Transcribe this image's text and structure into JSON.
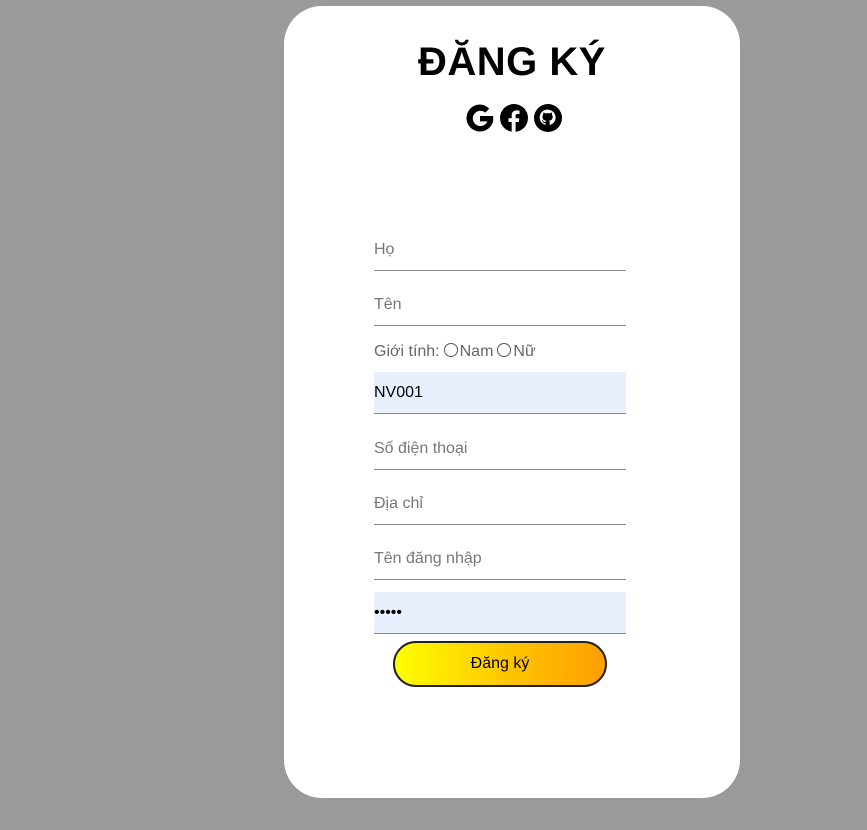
{
  "form": {
    "title": "ĐĂNG KÝ",
    "social_icons": [
      "google-icon",
      "facebook-icon",
      "github-icon"
    ],
    "fields": {
      "ho": {
        "placeholder": "Họ",
        "value": ""
      },
      "ten": {
        "placeholder": "Tên",
        "value": ""
      },
      "ma_nv": {
        "placeholder": "",
        "value": "NV001"
      },
      "so_dien_thoai": {
        "placeholder": "Số điện thoại",
        "value": ""
      },
      "dia_chi": {
        "placeholder": "Địa chỉ",
        "value": ""
      },
      "ten_dang_nhap": {
        "placeholder": "Tên đăng nhập",
        "value": ""
      },
      "mat_khau": {
        "placeholder": "",
        "value": "•••••"
      }
    },
    "gender": {
      "label": "Giới tính:",
      "options": [
        "Nam",
        "Nữ"
      ]
    },
    "submit_label": "Đăng ký"
  },
  "colors": {
    "background": "#9a9a9a",
    "card": "#ffffff",
    "autofill": "#e8f0fe",
    "button_gradient_start": "#ffff00",
    "button_gradient_end": "#ff9e00"
  }
}
